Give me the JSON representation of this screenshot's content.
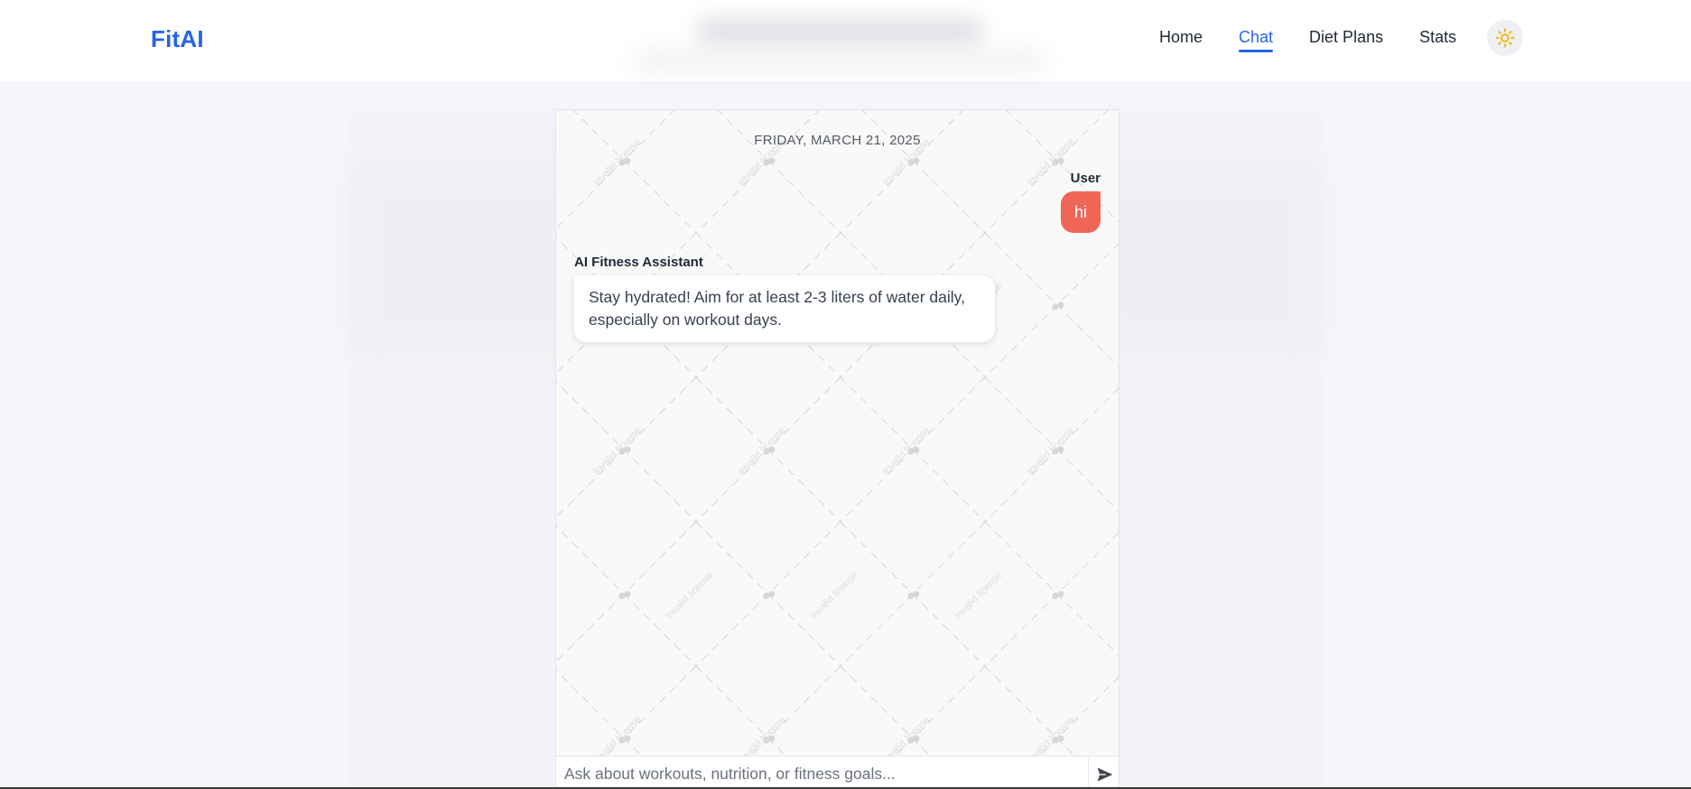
{
  "app": {
    "logo": "FitAI"
  },
  "nav": {
    "items": [
      {
        "label": "Home"
      },
      {
        "label": "Chat"
      },
      {
        "label": "Diet Plans"
      },
      {
        "label": "Stats"
      }
    ],
    "active": "Chat"
  },
  "theme_toggle": {
    "icon": "sun-icon",
    "color": "#f5b301"
  },
  "chat": {
    "date": "FRIDAY, MARCH 21, 2025",
    "watermark_text": "Invalid license",
    "messages": [
      {
        "sender": "User",
        "text": "hi"
      },
      {
        "sender": "AI Fitness Assistant",
        "text": "Stay hydrated! Aim for at least 2-3 liters of water daily, especially on workout days."
      }
    ],
    "input": {
      "placeholder": "Ask about workouts, nutrition, or fitness goals...",
      "value": ""
    },
    "send_icon": "send-icon"
  },
  "colors": {
    "brand": "#2563eb",
    "user_bubble": "#f06656"
  }
}
